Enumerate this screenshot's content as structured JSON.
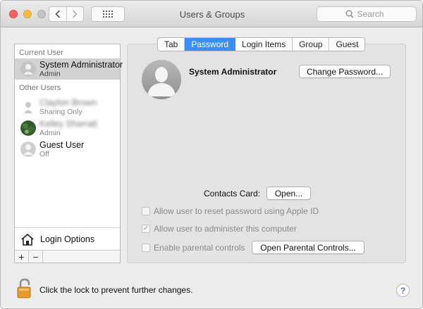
{
  "window": {
    "title": "Users & Groups",
    "search_placeholder": "Search"
  },
  "sidebar": {
    "current_user_label": "Current User",
    "other_users_label": "Other Users",
    "current_user": {
      "name": "System Administrator",
      "role": "Admin"
    },
    "other_users": [
      {
        "name": "Clayton Brown",
        "role": "Sharing Only",
        "blurred": true
      },
      {
        "name": "Kelley Sharratt",
        "role": "Admin",
        "blurred": true
      },
      {
        "name": "Guest User",
        "role": "Off",
        "blurred": false
      }
    ],
    "login_options_label": "Login Options",
    "add_button": "+",
    "remove_button": "−"
  },
  "tabs": [
    {
      "label": "Tab",
      "active": false
    },
    {
      "label": "Password",
      "active": true
    },
    {
      "label": "Login Items",
      "active": false
    },
    {
      "label": "Group",
      "active": false
    },
    {
      "label": "Guest",
      "active": false
    }
  ],
  "account": {
    "name": "System Administrator",
    "change_password_button": "Change Password...",
    "contacts_card_label": "Contacts Card:",
    "open_button": "Open...",
    "options": [
      {
        "label": "Allow user to reset password using Apple ID",
        "checked": false
      },
      {
        "label": "Allow user to administer this computer",
        "checked": true
      },
      {
        "label": "Enable parental controls",
        "checked": false
      }
    ],
    "open_parental_controls_button": "Open Parental Controls..."
  },
  "footer": {
    "lock_label": "Click the lock to prevent further changes.",
    "help_label": "?"
  },
  "colors": {
    "accent": "#3b8ef5",
    "selected_row": "#d2d2d2",
    "lock_orange": "#e89a2c"
  }
}
